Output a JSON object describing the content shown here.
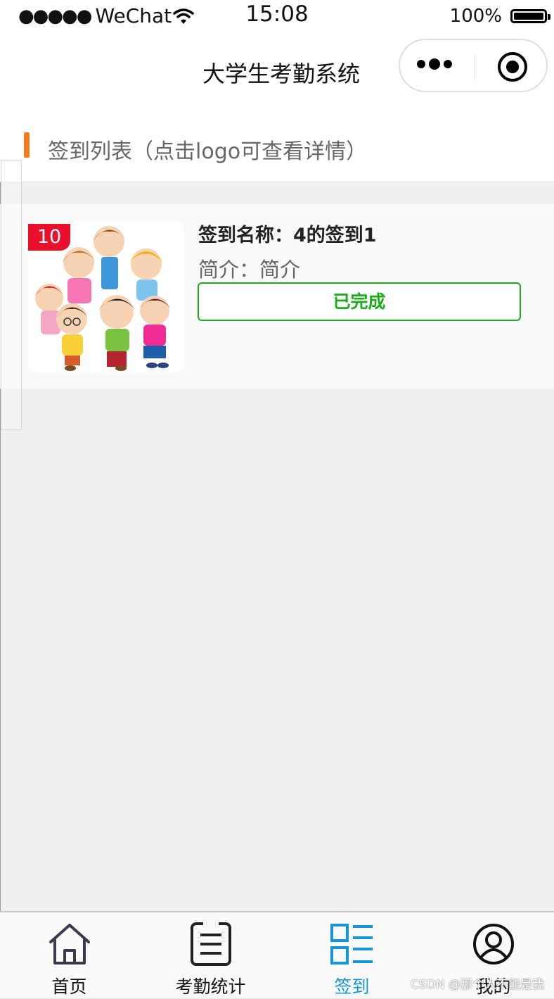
{
  "status_bar": {
    "signal_dots": "●●●●●",
    "carrier": "WeChat",
    "time": "15:08",
    "battery_percent": "100%"
  },
  "nav": {
    "title": "大学生考勤系统",
    "menu_icon": "more-dots-icon",
    "close_icon": "target-circle-icon"
  },
  "section": {
    "title": "签到列表（点击logo可查看详情）",
    "accent_color": "#f37c20"
  },
  "checkins": [
    {
      "badge": "10",
      "name": "签到名称：4的签到1",
      "intro": "简介：简介",
      "status": "已完成",
      "status_color": "#1aad19",
      "badge_color": "#e8112d"
    }
  ],
  "tabbar": {
    "active_color": "#1296db",
    "items": [
      {
        "label": "首页",
        "icon": "home-icon"
      },
      {
        "label": "考勤统计",
        "icon": "list-document-icon"
      },
      {
        "label": "签到",
        "icon": "signin-grid-icon"
      },
      {
        "label": "我的",
        "icon": "user-profile-icon"
      }
    ]
  },
  "watermark": "CSDN @那个人不能是我"
}
